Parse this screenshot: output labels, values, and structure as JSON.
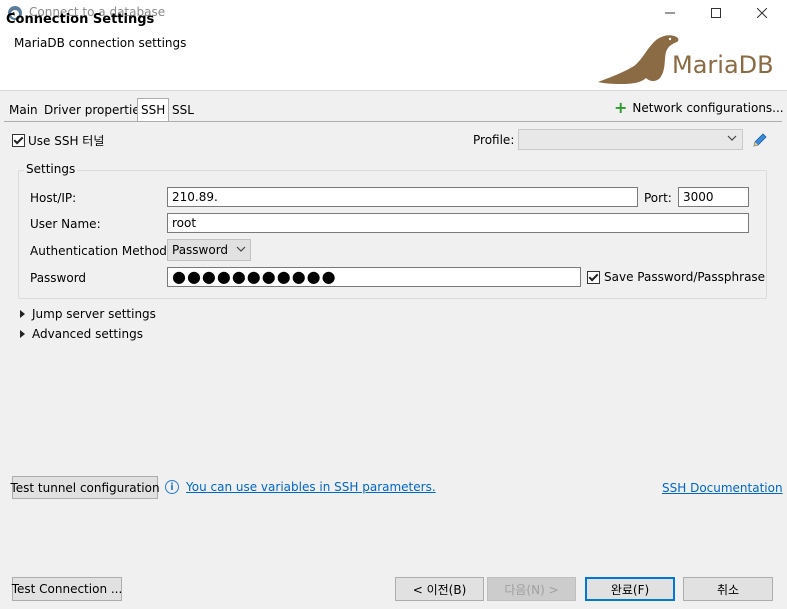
{
  "window": {
    "title": "Connect to a database",
    "minimize_icon": "minimize-icon",
    "maximize_icon": "maximize-icon",
    "close_icon": "close-icon"
  },
  "header": {
    "title": "Connection Settings",
    "subtitle": "MariaDB connection settings",
    "logo_text": "MariaDB",
    "logo_color": "#8a6b43"
  },
  "tabs": [
    {
      "label": "Main",
      "active": false
    },
    {
      "label": "Driver properties",
      "active": false
    },
    {
      "label": "SSH",
      "active": true
    },
    {
      "label": "SSL",
      "active": false
    }
  ],
  "network_configurations": "Network configurations...",
  "use_ssh": {
    "label": "Use SSH 터널",
    "checked": true
  },
  "profile": {
    "label": "Profile:",
    "value": ""
  },
  "settings": {
    "legend": "Settings",
    "host_label": "Host/IP:",
    "host_value": "210.89.",
    "port_label": "Port:",
    "port_value": "3000",
    "user_label": "User Name:",
    "user_value": "root",
    "auth_label": "Authentication Method:",
    "auth_value": "Password",
    "password_label": "Password",
    "password_mask": "●●●●●●●●●●●",
    "save_password_label": "Save Password/Passphrase",
    "save_password_checked": true
  },
  "expanders": {
    "jump": "Jump server settings",
    "advanced": "Advanced settings"
  },
  "bottom": {
    "test_tunnel": "Test tunnel configuration",
    "variables_link": "You can use variables in SSH parameters.",
    "ssh_docs_link": "SSH Documentation",
    "test_connection": "Test Connection ...",
    "back": "< 이전(B)",
    "next": "다음(N) >",
    "finish": "완료(F)",
    "cancel": "취소"
  },
  "colors": {
    "accent": "#0078d7",
    "link": "#0066cc",
    "plus_green": "#2e9a2e"
  }
}
